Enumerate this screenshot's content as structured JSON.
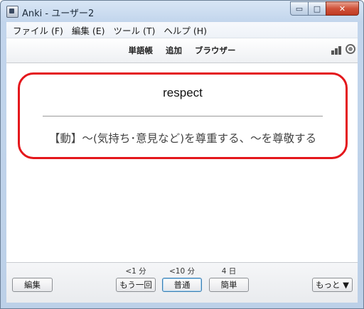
{
  "window": {
    "title": "Anki - ユーザー2",
    "minimize": "▭",
    "maximize": "□",
    "close": "✕"
  },
  "menu": {
    "items": [
      "ファイル (F)",
      "編集 (E)",
      "ツール (T)",
      "ヘルプ (H)"
    ]
  },
  "toolbar": {
    "decks": "単語帳",
    "add": "追加",
    "browse": "ブラウザー"
  },
  "card": {
    "front": "respect",
    "back": "【動】～(気持ち･意見など)を尊重する、～を尊敬する"
  },
  "bottom": {
    "edit_label": "編集",
    "more_label": "もっと ▼",
    "answers": [
      {
        "due": "<1 分",
        "label": "もう一回"
      },
      {
        "due": "<10 分",
        "label": "普通"
      },
      {
        "due": "4 日",
        "label": "簡単"
      }
    ]
  },
  "colors": {
    "card_border": "#e4171c",
    "default_button_border": "#3c7fb1"
  },
  "icons": [
    "stats-icon",
    "sync-icon",
    "app-icon"
  ]
}
